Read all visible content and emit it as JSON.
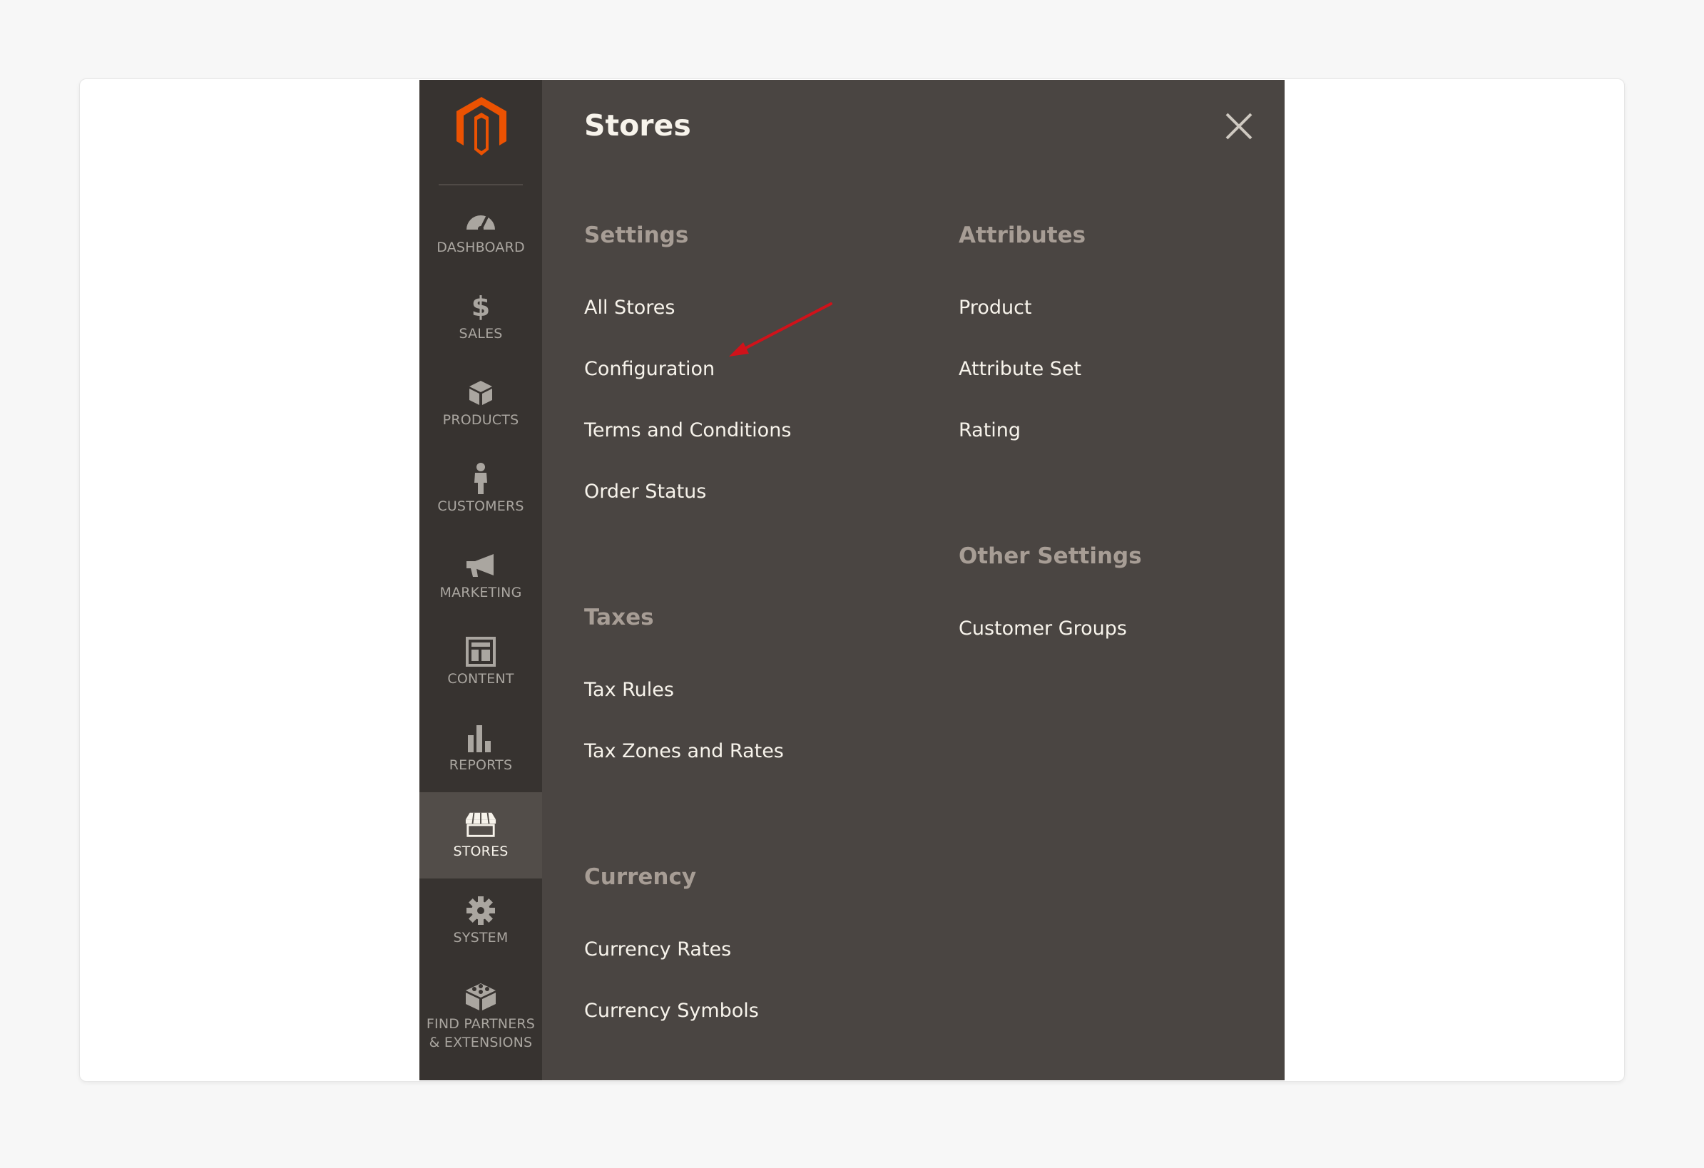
{
  "sidebar": {
    "logo_icon": "magento-logo-icon",
    "brand_color": "#eb5202",
    "items": [
      {
        "label": "DASHBOARD",
        "icon": "dashboard-icon"
      },
      {
        "label": "SALES",
        "icon": "dollar-icon"
      },
      {
        "label": "PRODUCTS",
        "icon": "box-icon"
      },
      {
        "label": "CUSTOMERS",
        "icon": "person-icon"
      },
      {
        "label": "MARKETING",
        "icon": "megaphone-icon"
      },
      {
        "label": "CONTENT",
        "icon": "layout-icon"
      },
      {
        "label": "REPORTS",
        "icon": "bar-chart-icon"
      },
      {
        "label": "STORES",
        "icon": "storefront-icon",
        "active": true
      },
      {
        "label": "SYSTEM",
        "icon": "gear-icon"
      },
      {
        "label": "FIND PARTNERS",
        "label2": "& EXTENSIONS",
        "icon": "extensions-icon"
      }
    ]
  },
  "panel": {
    "title": "Stores",
    "close_icon": "close-icon",
    "sections": {
      "settings": {
        "title": "Settings",
        "links": [
          "All Stores",
          "Configuration",
          "Terms and Conditions",
          "Order Status"
        ]
      },
      "taxes": {
        "title": "Taxes",
        "links": [
          "Tax Rules",
          "Tax Zones and Rates"
        ]
      },
      "currency": {
        "title": "Currency",
        "links": [
          "Currency Rates",
          "Currency Symbols"
        ]
      },
      "attributes": {
        "title": "Attributes",
        "links": [
          "Product",
          "Attribute Set",
          "Rating"
        ]
      },
      "other_settings": {
        "title": "Other Settings",
        "links": [
          "Customer Groups"
        ]
      }
    },
    "annotation_color": "#d0121a"
  }
}
